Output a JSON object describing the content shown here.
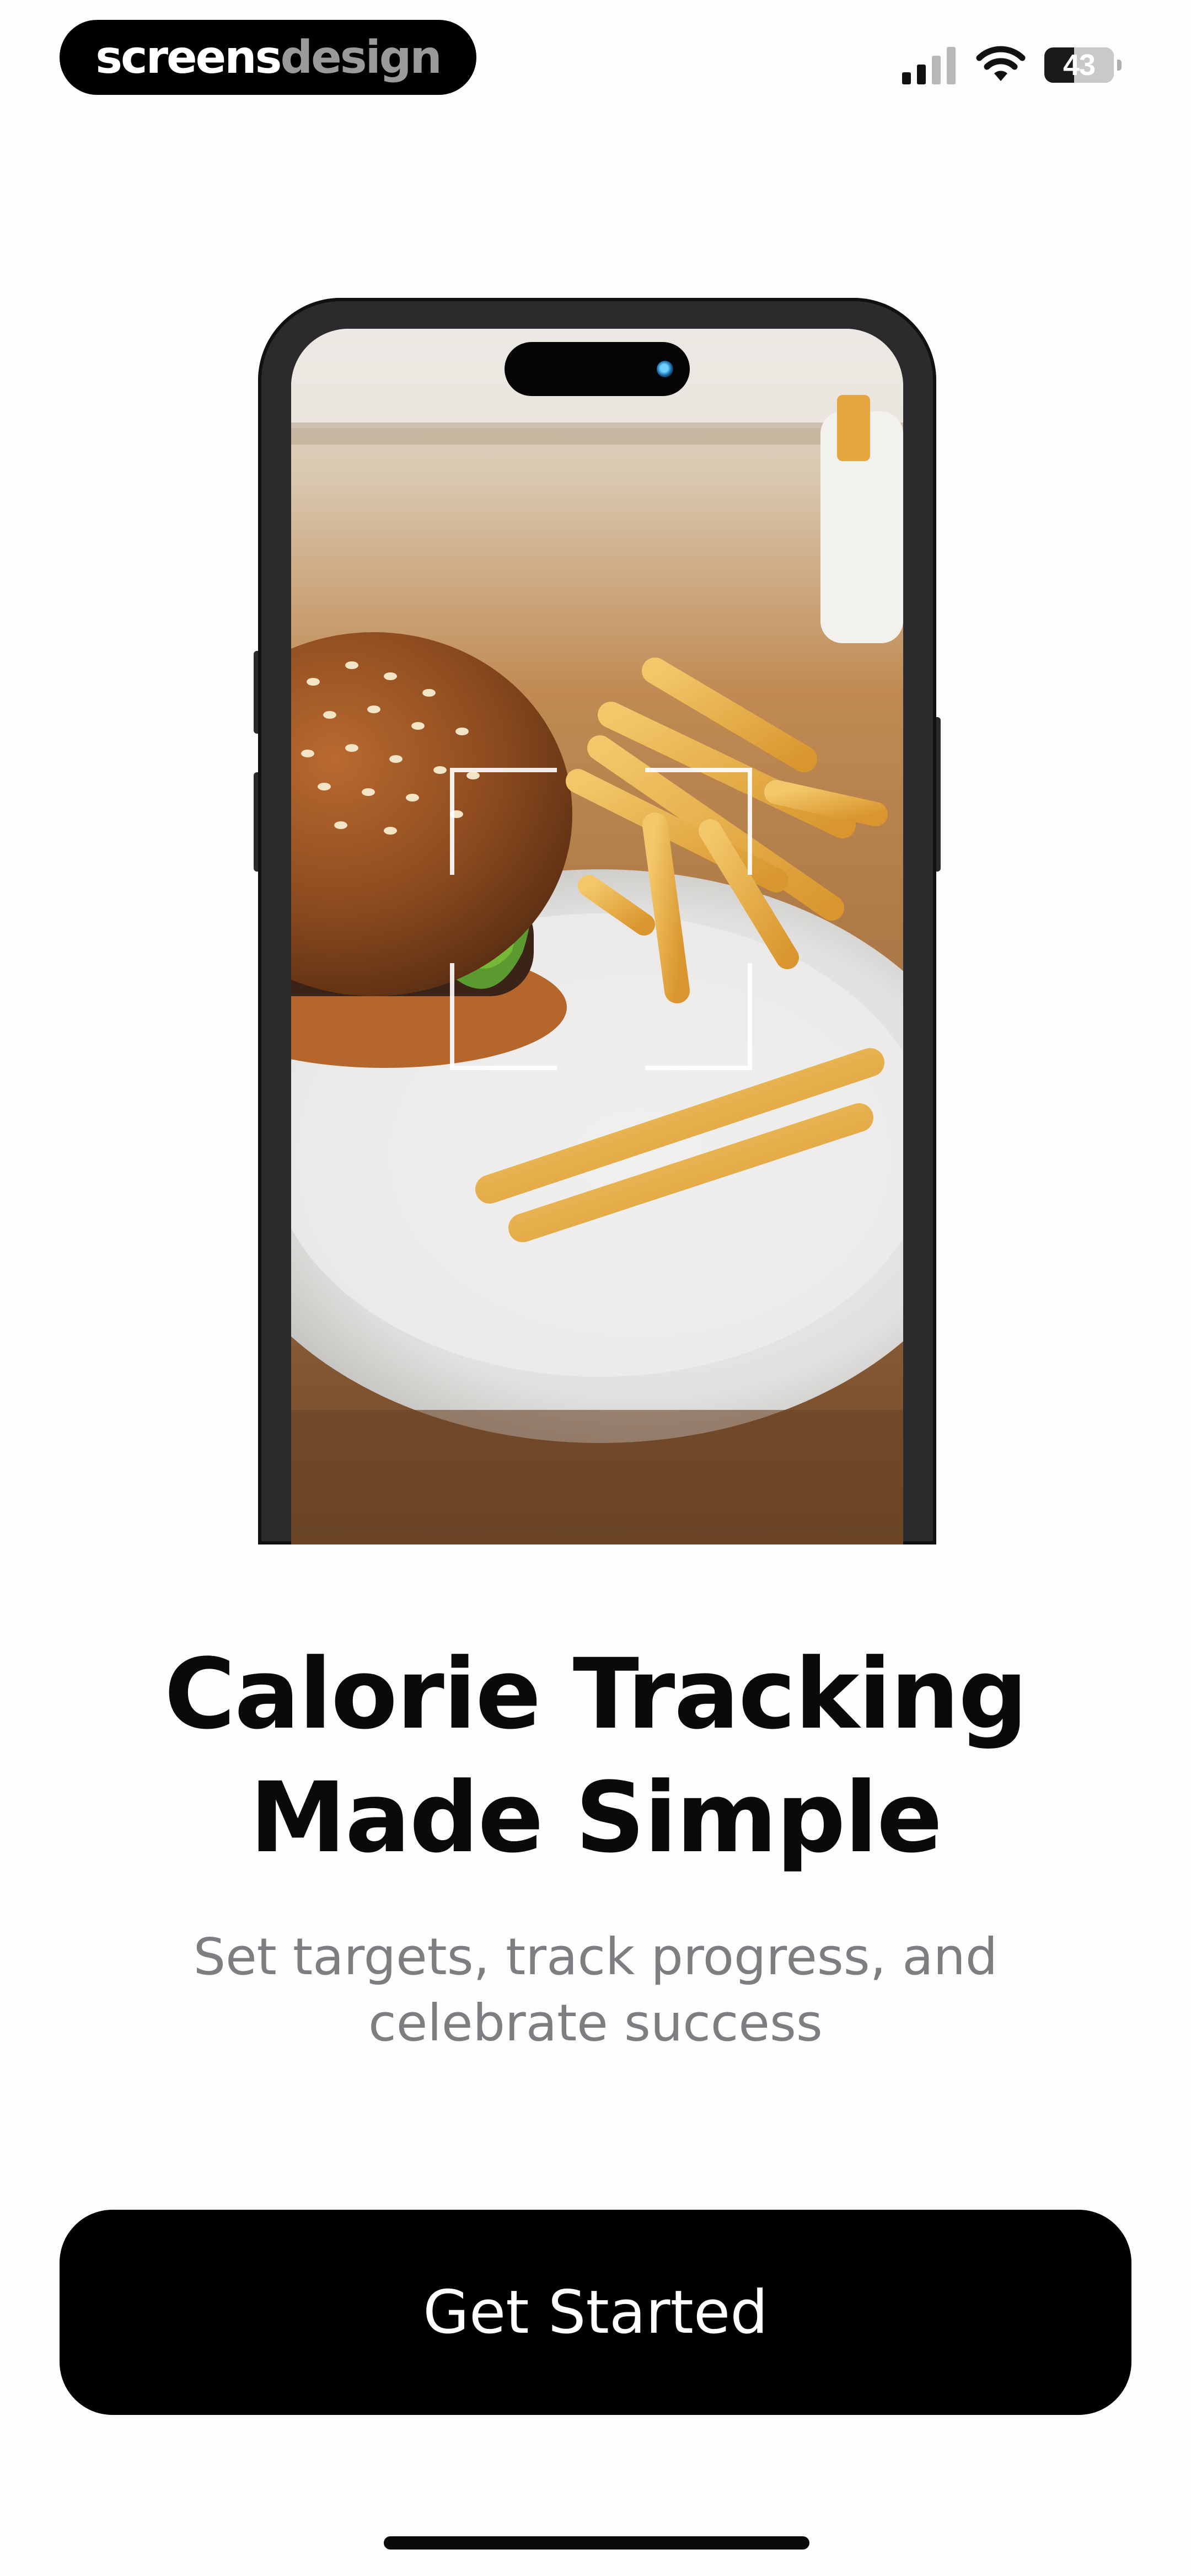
{
  "status_bar": {
    "brand_part1": "screens",
    "brand_part2": "design",
    "battery_percent": "43",
    "battery_level": 0.43
  },
  "hero": {
    "illustration": "phone-mockup-scanning-burger-and-fries"
  },
  "onboarding": {
    "title_line1": "Calorie Tracking",
    "title_line2": "Made Simple",
    "subtitle_line1": "Set targets, track progress, and",
    "subtitle_line2": "celebrate success"
  },
  "cta": {
    "label": "Get Started"
  },
  "colors": {
    "background": "#fdfdfd",
    "button": "#000000",
    "title_text": "#0a0a0a",
    "subtitle_text": "#7d7d82"
  }
}
